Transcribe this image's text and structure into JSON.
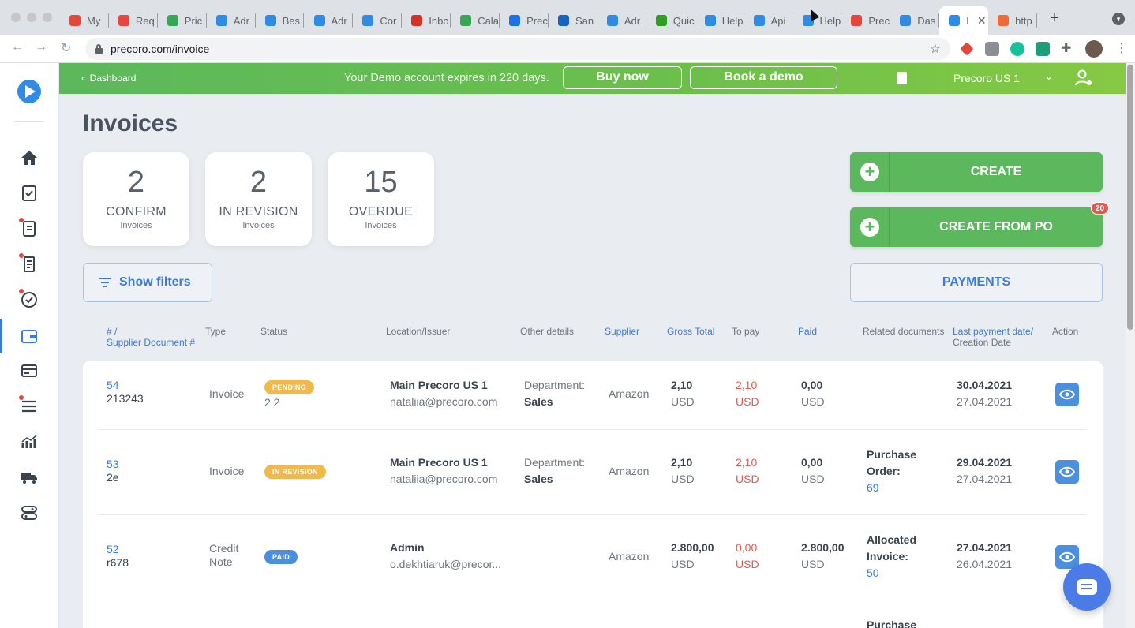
{
  "browser": {
    "tabs": [
      {
        "label": "My",
        "color": "#e8453c"
      },
      {
        "label": "Req",
        "color": "#e8453c"
      },
      {
        "label": "Pric",
        "color": "#34a853"
      },
      {
        "label": "Adr",
        "color": "#2e8be6"
      },
      {
        "label": "Bes",
        "color": "#2e8be6"
      },
      {
        "label": "Adr",
        "color": "#2e8be6"
      },
      {
        "label": "Cor",
        "color": "#2e8be6"
      },
      {
        "label": "Inbo",
        "color": "#d93025"
      },
      {
        "label": "Cala",
        "color": "#34a853"
      },
      {
        "label": "Prec",
        "color": "#1a73e8"
      },
      {
        "label": "San",
        "color": "#1565c0"
      },
      {
        "label": "Adr",
        "color": "#2e8be6"
      },
      {
        "label": "Quic",
        "color": "#2ca01c"
      },
      {
        "label": "Help",
        "color": "#2e8be6"
      },
      {
        "label": "Api",
        "color": "#2e8be6"
      },
      {
        "label": "Help",
        "color": "#2e8be6"
      },
      {
        "label": "Prec",
        "color": "#e8453c"
      },
      {
        "label": "Das",
        "color": "#2e8be6"
      },
      {
        "label": "I",
        "color": "#2e8be6"
      },
      {
        "label": "http",
        "color": "#f06a35"
      }
    ],
    "active_tab_index": 18,
    "url": "precoro.com/invoice"
  },
  "banner": {
    "back_label": "Dashboard",
    "message": "Your Demo account expires in 220 days.",
    "buy_label": "Buy now",
    "demo_label": "Book a demo",
    "company": "Precoro US 1"
  },
  "page": {
    "title": "Invoices",
    "stats": [
      {
        "count": "2",
        "label": "CONFIRM",
        "sub": "Invoices"
      },
      {
        "count": "2",
        "label": "IN REVISION",
        "sub": "Invoices"
      },
      {
        "count": "15",
        "label": "OVERDUE",
        "sub": "Invoices"
      }
    ],
    "create_label": "CREATE",
    "create_po_label": "CREATE FROM PO",
    "create_po_badge": "20",
    "filters_label": "Show filters",
    "payments_label": "PAYMENTS"
  },
  "table": {
    "headers": {
      "num1": "# /",
      "num2": "Supplier Document #",
      "type": "Type",
      "status": "Status",
      "location": "Location/Issuer",
      "other": "Other details",
      "supplier": "Supplier",
      "gross": "Gross Total",
      "topay": "To pay",
      "paid": "Paid",
      "related": "Related documents",
      "last1": "Last payment date/",
      "last2": "Creation Date",
      "action": "Action"
    },
    "rows": [
      {
        "id": "54",
        "doc": "213243",
        "type1": "Invoice",
        "type2": "",
        "status": "PENDING",
        "status_color": "#f0b94a",
        "status_note": "2 2",
        "location": "Main Precoro US 1",
        "issuer": "nataliia@precoro.com",
        "other1": "Department:",
        "other2": "Sales",
        "supplier": "Amazon",
        "gross": "2,10",
        "gross_cur": "USD",
        "topay": "2,10",
        "topay_cur": "USD",
        "paid": "0,00",
        "paid_cur": "USD",
        "rel1": "",
        "rel2": "",
        "rel_link": "",
        "last": "30.04.2021",
        "created": "27.04.2021"
      },
      {
        "id": "53",
        "doc": "2e",
        "type1": "Invoice",
        "type2": "",
        "status": "IN REVISION",
        "status_color": "#f0b94a",
        "status_note": "",
        "location": "Main Precoro US 1",
        "issuer": "nataliia@precoro.com",
        "other1": "Department:",
        "other2": "Sales",
        "supplier": "Amazon",
        "gross": "2,10",
        "gross_cur": "USD",
        "topay": "2,10",
        "topay_cur": "USD",
        "paid": "0,00",
        "paid_cur": "USD",
        "rel1": "Purchase",
        "rel2": "Order:",
        "rel_link": "69",
        "last": "29.04.2021",
        "created": "27.04.2021"
      },
      {
        "id": "52",
        "doc": "r678",
        "type1": "Credit",
        "type2": "Note",
        "status": "PAID",
        "status_color": "#4a8fe0",
        "status_note": "",
        "location": "Admin",
        "issuer": "o.dekhtiaruk@precor...",
        "other1": "",
        "other2": "",
        "supplier": "Amazon",
        "gross": "2.800,00",
        "gross_cur": "USD",
        "topay": "0,00",
        "topay_cur": "USD",
        "paid": "2.800,00",
        "paid_cur": "USD",
        "rel1": "Allocated",
        "rel2": "Invoice:",
        "rel_link": "50",
        "last": "27.04.2021",
        "created": "26.04.2021"
      }
    ],
    "partial_row_related": "Purchase"
  }
}
